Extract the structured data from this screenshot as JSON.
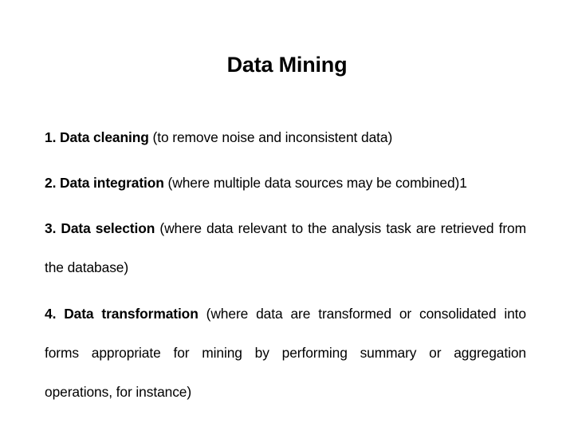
{
  "slide": {
    "title": "Data Mining",
    "background_color": "#ffffff",
    "text_color": "#000000"
  },
  "items": [
    {
      "number": "1.",
      "lead": "1. Data cleaning",
      "rest": " (to remove noise and inconsistent data)",
      "tail": "",
      "full_text": "1. Data cleaning (to remove noise and inconsistent data)",
      "wraps": false
    },
    {
      "number": "2.",
      "lead": "2. Data integration",
      "rest": " (where multiple data sources may be combined)",
      "tail": "1",
      "full_text": "2. Data integration (where multiple data sources may be combined)1",
      "wraps": false
    },
    {
      "number": "3.",
      "lead": "3. Data selection",
      "rest": " (where data relevant to the analysis task are retrieved from the database)",
      "tail": "",
      "full_text": "3. Data selection (where data relevant to the analysis task are retrieved from the database)",
      "wraps": true
    },
    {
      "number": "4.",
      "lead": "4. Data transformation",
      "rest": " (where data are transformed or consolidated into forms appropriate for mining by performing summary or aggregation operations, for instance)",
      "tail": "",
      "full_text": "4. Data transformation (where data are transformed or consolidated into forms appropriate for mining by performing summary or aggregation operations, for instance)",
      "wraps": true
    }
  ]
}
